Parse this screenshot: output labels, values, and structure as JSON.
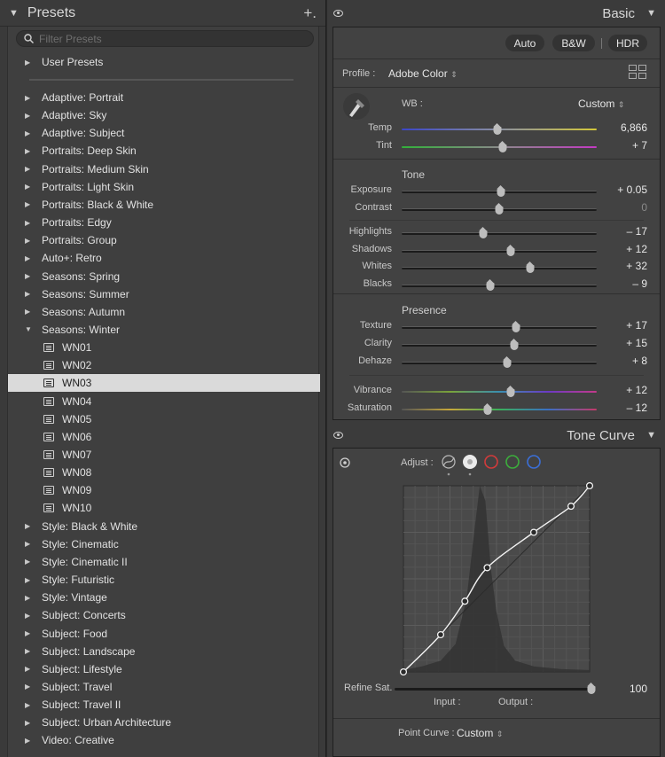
{
  "presets_panel": {
    "title": "Presets",
    "add_icon": "plus-icon",
    "filter_placeholder": "Filter Presets",
    "items": [
      {
        "label": "User Presets",
        "expanded": false
      },
      {
        "label": "Adaptive: Portrait",
        "expanded": false
      },
      {
        "label": "Adaptive: Sky",
        "expanded": false
      },
      {
        "label": "Adaptive: Subject",
        "expanded": false
      },
      {
        "label": "Portraits: Deep Skin",
        "expanded": false
      },
      {
        "label": "Portraits: Medium Skin",
        "expanded": false
      },
      {
        "label": "Portraits: Light Skin",
        "expanded": false
      },
      {
        "label": "Portraits: Black & White",
        "expanded": false
      },
      {
        "label": "Portraits: Edgy",
        "expanded": false
      },
      {
        "label": "Portraits: Group",
        "expanded": false
      },
      {
        "label": "Auto+: Retro",
        "expanded": false
      },
      {
        "label": "Seasons: Spring",
        "expanded": false
      },
      {
        "label": "Seasons: Summer",
        "expanded": false
      },
      {
        "label": "Seasons: Autumn",
        "expanded": false
      },
      {
        "label": "Seasons: Winter",
        "expanded": true,
        "children": [
          "WN01",
          "WN02",
          "WN03",
          "WN04",
          "WN05",
          "WN06",
          "WN07",
          "WN08",
          "WN09",
          "WN10"
        ],
        "selected": "WN03"
      },
      {
        "label": "Style: Black & White",
        "expanded": false
      },
      {
        "label": "Style: Cinematic",
        "expanded": false
      },
      {
        "label": "Style: Cinematic II",
        "expanded": false
      },
      {
        "label": "Style: Futuristic",
        "expanded": false
      },
      {
        "label": "Style: Vintage",
        "expanded": false
      },
      {
        "label": "Subject: Concerts",
        "expanded": false
      },
      {
        "label": "Subject: Food",
        "expanded": false
      },
      {
        "label": "Subject: Landscape",
        "expanded": false
      },
      {
        "label": "Subject: Lifestyle",
        "expanded": false
      },
      {
        "label": "Subject: Travel",
        "expanded": false
      },
      {
        "label": "Subject: Travel II",
        "expanded": false
      },
      {
        "label": "Subject: Urban Architecture",
        "expanded": false
      },
      {
        "label": "Video: Creative",
        "expanded": false
      }
    ]
  },
  "basic_panel": {
    "title": "Basic",
    "buttons": {
      "auto": "Auto",
      "bw": "B&W",
      "hdr": "HDR"
    },
    "profile_label": "Profile :",
    "profile_value": "Adobe Color",
    "wb_label": "WB :",
    "wb_value": "Custom",
    "tone_label": "Tone",
    "presence_label": "Presence",
    "sliders": {
      "temp": {
        "label": "Temp",
        "value": "6,866",
        "pos": 0.49
      },
      "tint": {
        "label": "Tint",
        "value": "+ 7",
        "pos": 0.52
      },
      "exposure": {
        "label": "Exposure",
        "value": "+ 0.05",
        "pos": 0.51
      },
      "contrast": {
        "label": "Contrast",
        "value": "0",
        "pos": 0.5
      },
      "highlights": {
        "label": "Highlights",
        "value": "– 17",
        "pos": 0.42
      },
      "shadows": {
        "label": "Shadows",
        "value": "+ 12",
        "pos": 0.56
      },
      "whites": {
        "label": "Whites",
        "value": "+ 32",
        "pos": 0.66
      },
      "blacks": {
        "label": "Blacks",
        "value": "– 9",
        "pos": 0.455
      },
      "texture": {
        "label": "Texture",
        "value": "+ 17",
        "pos": 0.585
      },
      "clarity": {
        "label": "Clarity",
        "value": "+ 15",
        "pos": 0.575
      },
      "dehaze": {
        "label": "Dehaze",
        "value": "+ 8",
        "pos": 0.54
      },
      "vibrance": {
        "label": "Vibrance",
        "value": "+ 12",
        "pos": 0.56
      },
      "saturation": {
        "label": "Saturation",
        "value": "– 12",
        "pos": 0.44
      }
    }
  },
  "tone_curve_panel": {
    "title": "Tone Curve",
    "adjust_label": "Adjust :",
    "refine_label": "Refine Sat.",
    "refine_value": "100",
    "refine_pos": 1.0,
    "input_label": "Input :",
    "output_label": "Output :",
    "point_curve_label": "Point Curve :",
    "point_curve_value": "Custom",
    "channel_colors": {
      "red": "#d23b3b",
      "green": "#3cae3c",
      "blue": "#3b6fd8"
    },
    "curve_points": [
      [
        0,
        0
      ],
      [
        0.2,
        0.2
      ],
      [
        0.33,
        0.38
      ],
      [
        0.45,
        0.56
      ],
      [
        0.7,
        0.75
      ],
      [
        0.9,
        0.89
      ],
      [
        1,
        1
      ]
    ]
  }
}
